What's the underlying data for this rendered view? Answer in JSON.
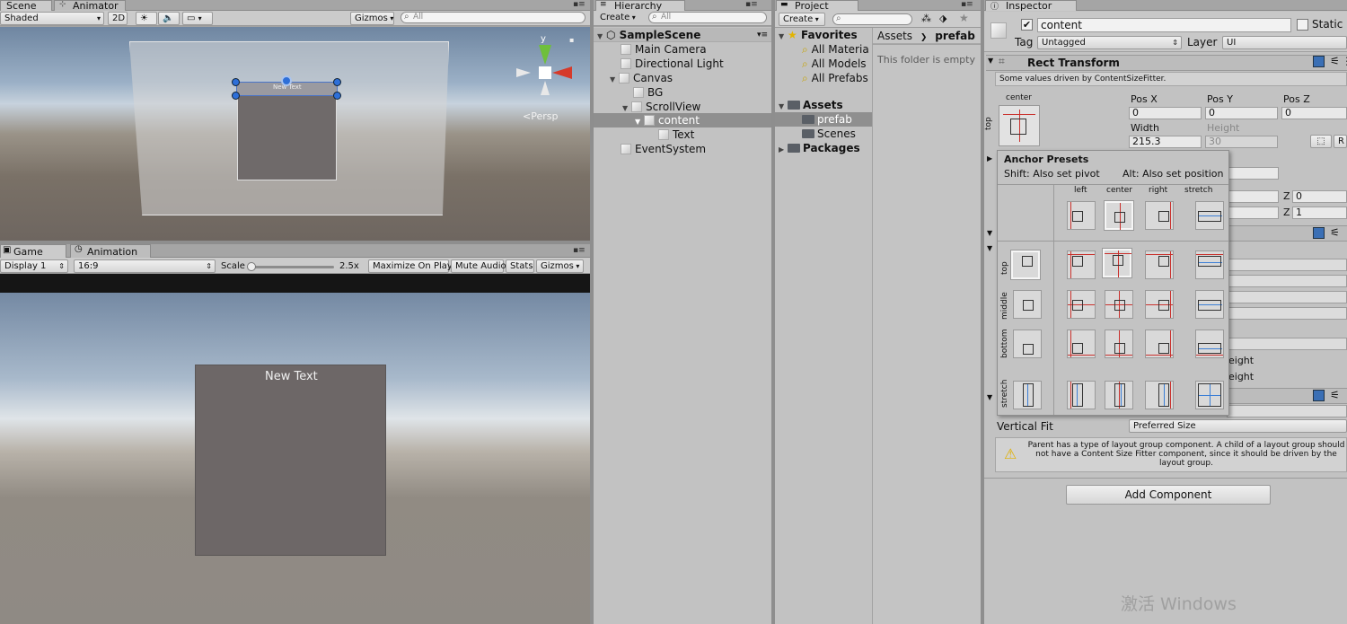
{
  "scene": {
    "tabs": [
      "Scene",
      "Animator"
    ],
    "shading": "Shaded",
    "btn_2d": "2D",
    "gizmos": "Gizmos",
    "search_placeholder": "All",
    "persp": "<Persp",
    "gizmo_axis_y": "y",
    "new_text_label": "New Text"
  },
  "game": {
    "tabs": [
      "Game",
      "Animation"
    ],
    "display": "Display 1",
    "aspect": "16:9",
    "scale_label": "Scale",
    "scale_value": "2.5x",
    "maximize_on_play": "Maximize On Play",
    "mute_audio": "Mute Audio",
    "stats": "Stats",
    "gizmos": "Gizmos",
    "new_text": "New Text"
  },
  "hierarchy": {
    "tab": "Hierarchy",
    "create": "Create",
    "search_placeholder": "All",
    "scene_name": "SampleScene",
    "items": [
      "Main Camera",
      "Directional Light",
      "Canvas",
      "BG",
      "ScrollView",
      "content",
      "Text",
      "EventSystem"
    ]
  },
  "project": {
    "tab": "Project",
    "create": "Create",
    "favorites": "Favorites",
    "favorites_items": [
      "All Materia",
      "All Models",
      "All Prefabs"
    ],
    "assets": "Assets",
    "assets_items": [
      "prefab",
      "Scenes"
    ],
    "packages": "Packages",
    "breadcrumb": [
      "Assets",
      "prefab"
    ],
    "empty_message": "This folder is empty"
  },
  "inspector": {
    "tab": "Inspector",
    "object_name": "content",
    "static_label": "Static",
    "tag_label": "Tag",
    "tag_value": "Untagged",
    "layer_label": "Layer",
    "layer_value": "UI",
    "rect_transform_title": "Rect Transform",
    "driven_notice": "Some values driven by ContentSizeFitter.",
    "anchor_horizontal": "center",
    "anchor_vertical": "top",
    "pos_x_label": "Pos X",
    "pos_x": "0",
    "pos_y_label": "Pos Y",
    "pos_y": "0",
    "pos_z_label": "Pos Z",
    "pos_z": "0",
    "width_label": "Width",
    "width": "215.3",
    "height_label": "Height",
    "height": "30",
    "r_button": "R",
    "z_label": "Z",
    "rot_z": "0",
    "scale_z": "1",
    "eight_1": "eight",
    "eight_2": "eight",
    "vertical_fit_label": "Vertical Fit",
    "vertical_fit_value": "Preferred Size",
    "warning": "Parent has a type of layout group component. A child of a layout group should not have a Content Size Fitter component, since it should be driven by the layout group.",
    "add_component": "Add Component"
  },
  "anchor_presets": {
    "title": "Anchor Presets",
    "shift_hint": "Shift: Also set pivot",
    "alt_hint": "Alt: Also set position",
    "columns": [
      "left",
      "center",
      "right",
      "stretch"
    ],
    "rows": [
      "top",
      "middle",
      "bottom",
      "stretch"
    ]
  },
  "watermark": "激活 Windows",
  "colors": {
    "selection": "#8f8f8f",
    "anchor_red": "#c9302c",
    "anchor_blue": "#3c7fd6",
    "handle_blue": "#2e6fd8"
  }
}
